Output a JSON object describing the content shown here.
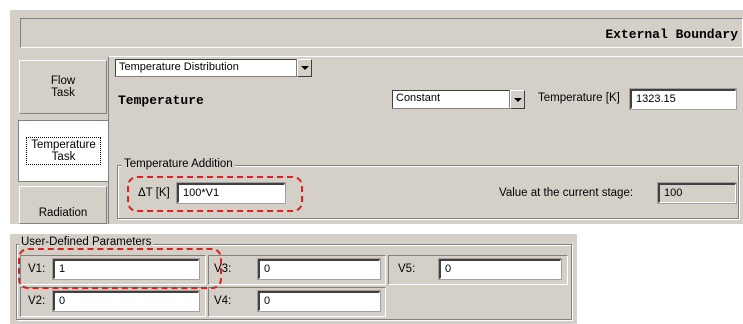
{
  "header": {
    "title": "External Boundary"
  },
  "tabs": [
    {
      "label": "Flow\nTask",
      "active": false
    },
    {
      "label": "Temperature\nTask",
      "active": true
    },
    {
      "label": "Radiation",
      "active": false
    }
  ],
  "distribution_select": {
    "value": "Temperature Distribution"
  },
  "temperature": {
    "heading": "Temperature",
    "mode_select": "Constant",
    "label": "Temperature [K]",
    "value": "1323.15"
  },
  "temperature_addition": {
    "legend": "Temperature Addition",
    "delta_label": "ΔT [K]",
    "delta_value": "100*V1",
    "current_label": "Value at the current stage:",
    "current_value": "100"
  },
  "user_params": {
    "legend": "User-Defined Parameters",
    "items": [
      {
        "label": "V1:",
        "value": "1"
      },
      {
        "label": "V2:",
        "value": "0"
      },
      {
        "label": "V3:",
        "value": "0"
      },
      {
        "label": "V4:",
        "value": "0"
      },
      {
        "label": "V5:",
        "value": "0"
      }
    ]
  },
  "colors": {
    "panel": "#d4d0c8",
    "highlight": "#e02020"
  }
}
